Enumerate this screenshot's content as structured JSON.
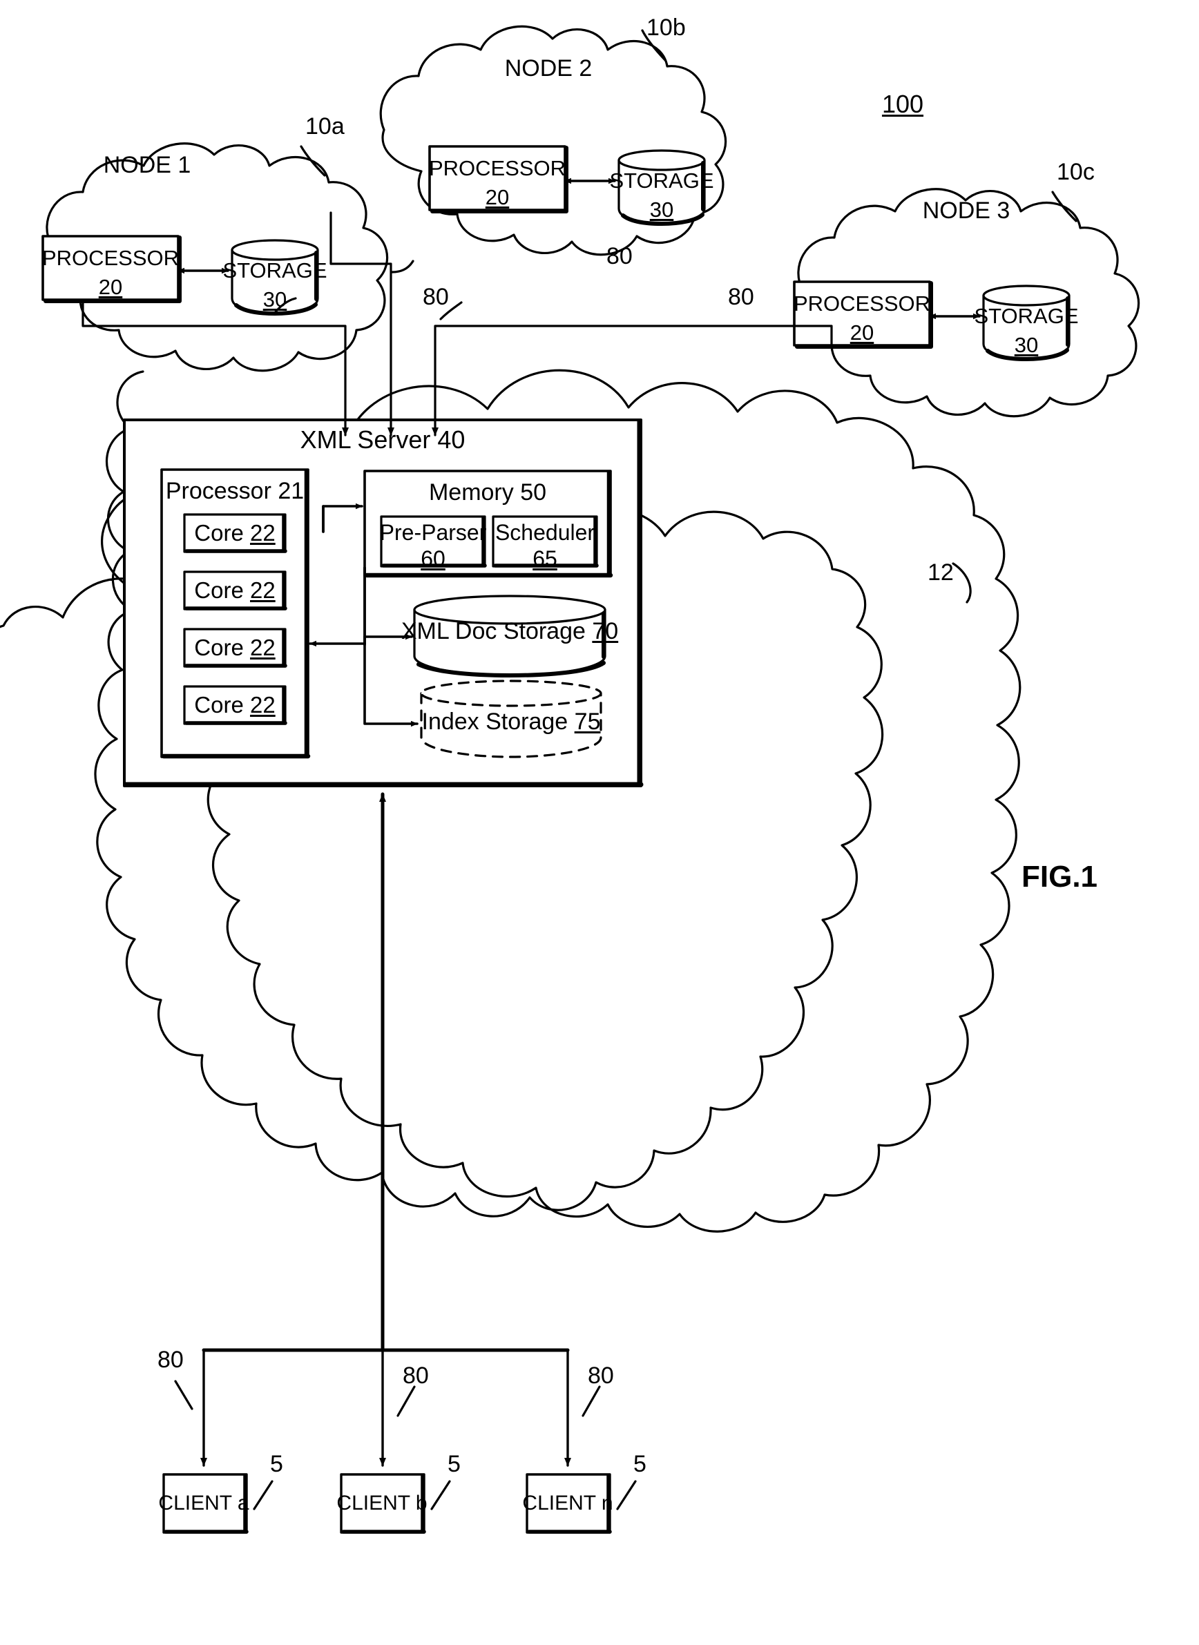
{
  "figure": {
    "label": "FIG.1",
    "system_ref": "100",
    "server_cloud_ref": "12"
  },
  "nodes": [
    {
      "id": "node1",
      "title": "NODE 1",
      "ref": "10a",
      "processor": {
        "label": "PROCESSOR",
        "ref": "20"
      },
      "storage": {
        "label": "STORAGE",
        "ref": "30"
      }
    },
    {
      "id": "node2",
      "title": "NODE 2",
      "ref": "10b",
      "processor": {
        "label": "PROCESSOR",
        "ref": "20"
      },
      "storage": {
        "label": "STORAGE",
        "ref": "30"
      }
    },
    {
      "id": "node3",
      "title": "NODE 3",
      "ref": "10c",
      "processor": {
        "label": "PROCESSOR",
        "ref": "20"
      },
      "storage": {
        "label": "STORAGE",
        "ref": "30"
      }
    }
  ],
  "server": {
    "title": "XML Server 40",
    "processor": {
      "title": "Processor 21",
      "cores": [
        {
          "label": "Core",
          "ref": "22"
        },
        {
          "label": "Core",
          "ref": "22"
        },
        {
          "label": "Core",
          "ref": "22"
        },
        {
          "label": "Core",
          "ref": "22"
        }
      ]
    },
    "memory": {
      "title": "Memory 50",
      "modules": [
        {
          "label": "Pre-Parser",
          "ref": "60"
        },
        {
          "label": "Scheduler",
          "ref": "65"
        }
      ]
    },
    "doc_storage": {
      "label": "XML Doc Storage",
      "ref": "70"
    },
    "index_storage": {
      "label": "Index Storage",
      "ref": "75"
    }
  },
  "clients": [
    {
      "label": "CLIENT a",
      "ref": "5"
    },
    {
      "label": "CLIENT b",
      "ref": "5"
    },
    {
      "label": "CLIENT n",
      "ref": "5"
    }
  ],
  "link_refs": {
    "node1_link": "80",
    "node2_link": "80",
    "node3_link": "80",
    "client_a_link": "80",
    "client_b_link": "80",
    "client_n_link": "80"
  }
}
